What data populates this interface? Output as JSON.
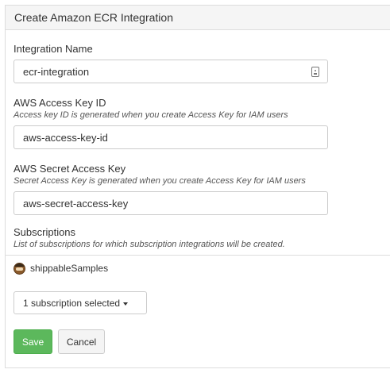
{
  "panel": {
    "title": "Create Amazon ECR Integration"
  },
  "form": {
    "integration_name": {
      "label": "Integration Name",
      "value": "ecr-integration",
      "icon": "contact-card-icon"
    },
    "access_key": {
      "label": "AWS Access Key ID",
      "help": "Access key ID is generated when you create Access Key for IAM users",
      "value": "aws-access-key-id"
    },
    "secret_key": {
      "label": "AWS Secret Access Key",
      "help": "Secret Access Key is generated when you create Access Key for IAM users",
      "value": "aws-secret-access-key"
    },
    "subscriptions": {
      "label": "Subscriptions",
      "help": "List of subscriptions for which subscription integrations will be created.",
      "org_name": "shippableSamples",
      "dropdown_label": "1 subscription selected"
    }
  },
  "actions": {
    "save_label": "Save",
    "cancel_label": "Cancel"
  },
  "colors": {
    "save": "#5cb85c",
    "heading_bg": "#f5f5f5",
    "border": "#dddddd"
  }
}
